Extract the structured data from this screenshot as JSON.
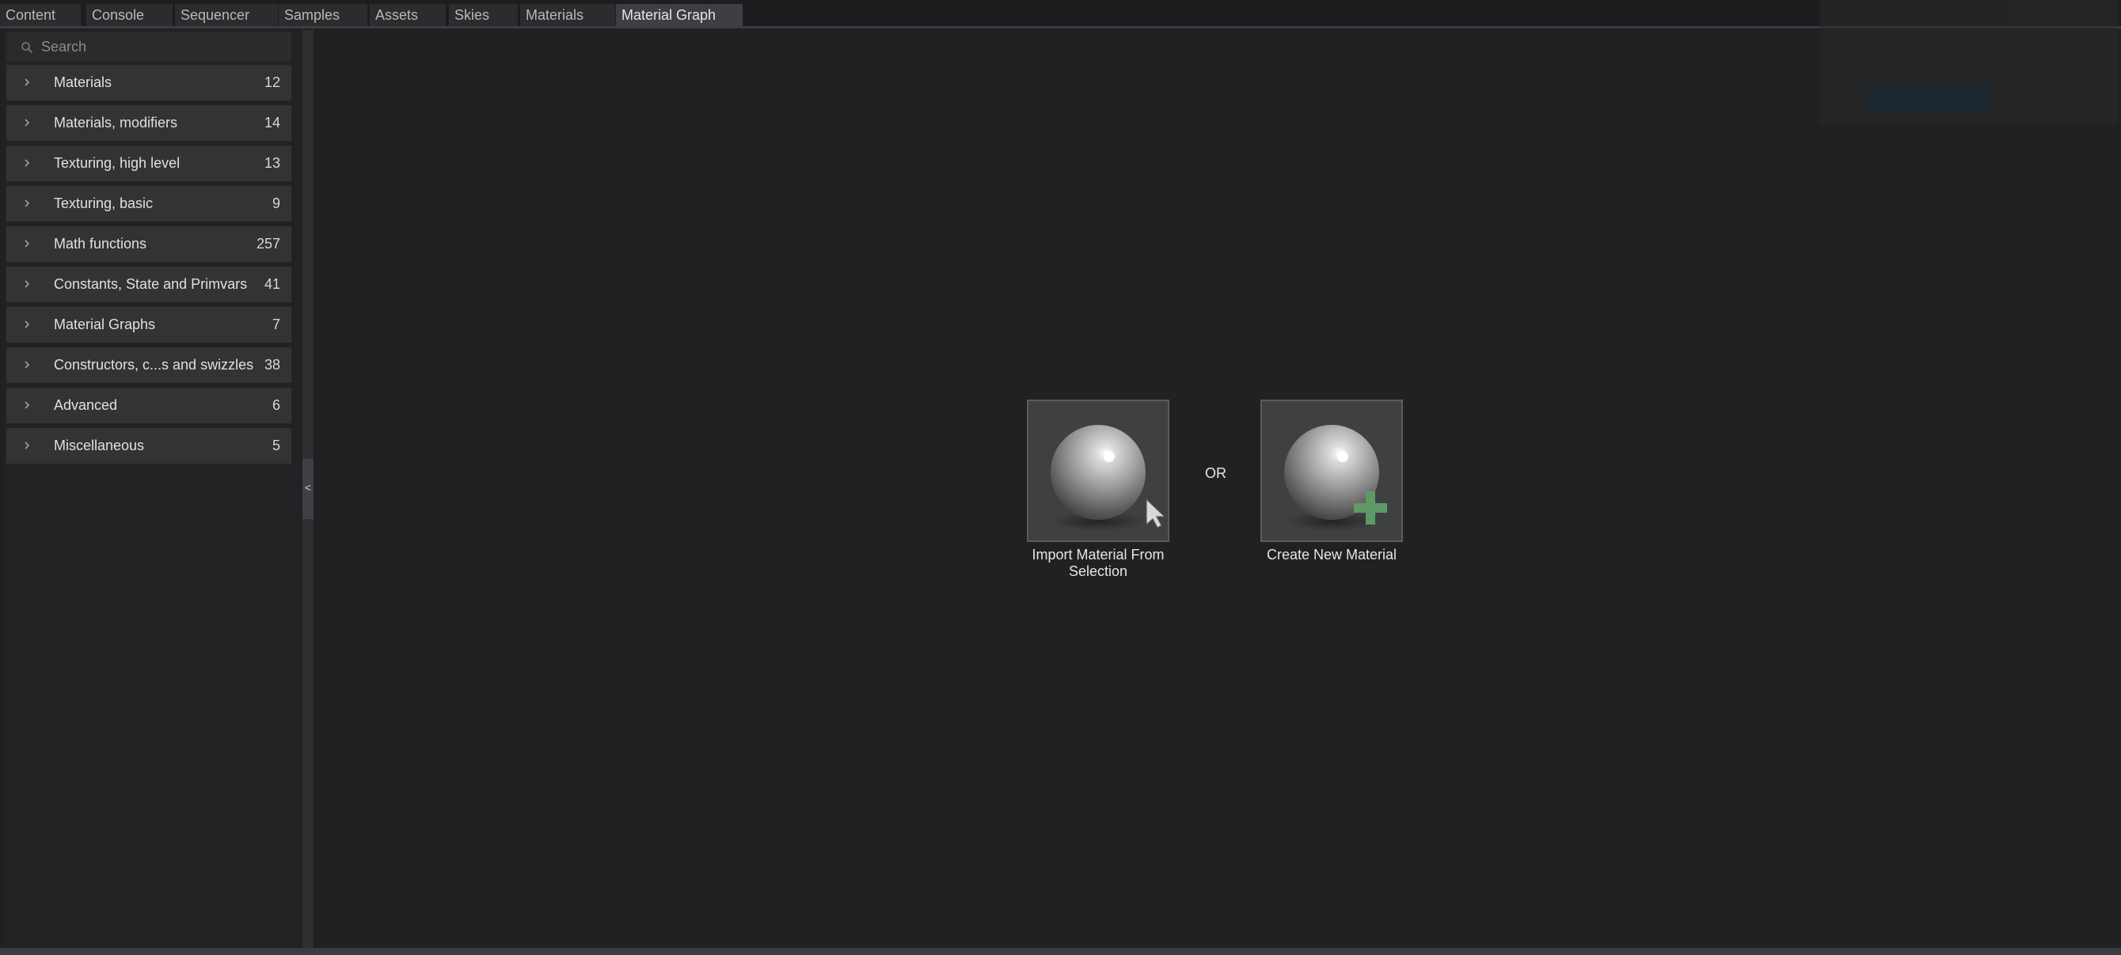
{
  "tabs": [
    {
      "label": "Content"
    },
    {
      "label": "Console"
    },
    {
      "label": "Sequencer"
    },
    {
      "label": "Samples"
    },
    {
      "label": "Assets"
    },
    {
      "label": "Skies"
    },
    {
      "label": "Materials"
    },
    {
      "label": "Material Graph",
      "active": true
    }
  ],
  "search": {
    "placeholder": "Search"
  },
  "categories": [
    {
      "label": "Materials",
      "count": "12"
    },
    {
      "label": "Materials, modifiers",
      "count": "14"
    },
    {
      "label": "Texturing, high level",
      "count": "13"
    },
    {
      "label": "Texturing, basic",
      "count": "9"
    },
    {
      "label": "Math functions",
      "count": "257"
    },
    {
      "label": "Constants, State and Primvars",
      "count": "41"
    },
    {
      "label": "Material Graphs",
      "count": "7"
    },
    {
      "label": "Constructors, c...s and swizzles",
      "count": "38"
    },
    {
      "label": "Advanced",
      "count": "6"
    },
    {
      "label": "Miscellaneous",
      "count": "5"
    }
  ],
  "splitter": {
    "arrow": "<"
  },
  "main": {
    "import_label": "Import Material From Selection",
    "or_label": "OR",
    "create_label": "Create New Material"
  },
  "colors": {
    "background": "#1f2022",
    "panel_item": "#323335",
    "active_tab": "#3e3f42",
    "plus_icon": "#5f9a66"
  }
}
